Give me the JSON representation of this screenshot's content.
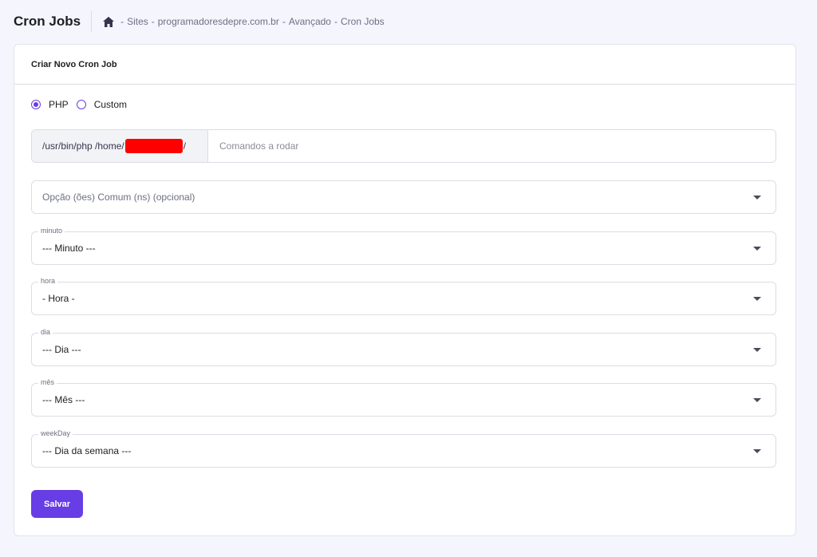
{
  "header": {
    "title": "Cron Jobs",
    "breadcrumb": {
      "home_icon": "home-icon",
      "separator": "-",
      "items": [
        "Sites",
        "programadoresdepre.com.br",
        "Avançado",
        "Cron Jobs"
      ]
    }
  },
  "card": {
    "title": "Criar Novo Cron Job",
    "radios": [
      {
        "label": "PHP",
        "selected": true
      },
      {
        "label": "Custom",
        "selected": false
      }
    ],
    "command": {
      "prefix_start": "/usr/bin/php /home/",
      "prefix_end": "/",
      "value": "",
      "placeholder": "Comandos a rodar"
    },
    "common_options": {
      "placeholder": "Opção (ões) Comum (ns) (opcional)"
    },
    "selects": [
      {
        "label": "minuto",
        "value": "--- Minuto ---"
      },
      {
        "label": "hora",
        "value": "- Hora -"
      },
      {
        "label": "dia",
        "value": "--- Dia ---"
      },
      {
        "label": "mês",
        "value": "--- Mês ---"
      },
      {
        "label": "weekDay",
        "value": "--- Dia da semana ---"
      }
    ],
    "save_label": "Salvar"
  },
  "colors": {
    "accent": "#673de6",
    "background": "#f4f5fd",
    "redaction": "#ff0000"
  }
}
